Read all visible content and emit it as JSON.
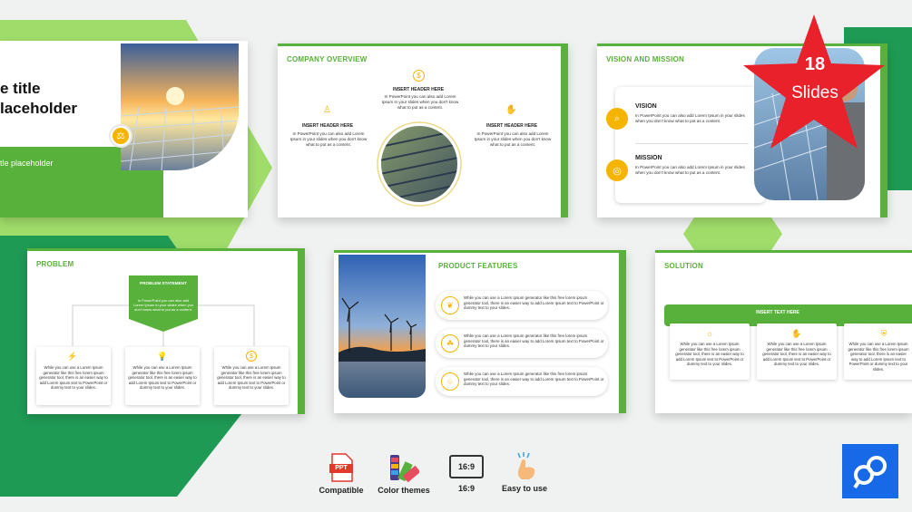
{
  "colors": {
    "accent_green": "#58b13a",
    "light_green": "#9fdc6a",
    "dark_green": "#1f9a55",
    "yellow_icon": "#f4b400",
    "star_red": "#e8212b",
    "logo_blue": "#1769e8"
  },
  "badge": {
    "count": "18",
    "label": "Slides"
  },
  "slide1": {
    "title_line1": "e title",
    "title_line2": "laceholder",
    "subtitle": "tle placeholder"
  },
  "slide2": {
    "title": "COMPANY OVERVIEW",
    "center_header": "INSERT HEADER HERE",
    "center_text": "In PowerPoint you can also add Lorem Ipsum in your slides when you don't know what to put as a content.",
    "left_header": "INSERT HEADER HERE",
    "left_text": "In PowerPoint you can also add Lorem Ipsum in your slides when you don't know what to put as a content.",
    "right_header": "INSERT HEADER HERE",
    "right_text": "In PowerPoint you can also add Lorem Ipsum in your slides when you don't know what to put as a content."
  },
  "slide3": {
    "title": "VISION AND MISSION",
    "vision_header": "VISION",
    "vision_text": "In PowerPoint you can also add Lorem Ipsum in your slides when you don't know what to put as a content.",
    "mission_header": "MISSION",
    "mission_text": "In PowerPoint you can also add Lorem Ipsum in your slides when you don't know what to put as a content."
  },
  "slide4": {
    "title": "PROBLEM",
    "statement_header": "PROBLEM STATEMENT",
    "statement_text": "In PowerPoint you can also add Lorem Ipsum in your slides when you don't know what to put as a content.",
    "cards": [
      "While you can use a Lorem Ipsum generator like this free lorem ipsum generator tool, there is an easier way to add Lorem Ipsum text to PowerPoint or dummy text to your slides.",
      "While you can use a Lorem Ipsum generator like this free lorem ipsum generator tool, there is an easier way to add Lorem Ipsum text to PowerPoint or dummy text to your slides.",
      "While you can use a Lorem Ipsum generator like this free lorem ipsum generator tool, there is an easier way to add Lorem Ipsum text to PowerPoint or dummy text to your slides."
    ]
  },
  "slide5": {
    "title": "PRODUCT FEATURES",
    "features": [
      "While you can use a Lorem Ipsum generator like this free lorem ipsum generator tool, there is an easier way to add Lorem Ipsum text to PowerPoint or dummy text to your slides.",
      "While you can use a Lorem Ipsum generator like this free lorem ipsum generator tool, there is an easier way to add Lorem Ipsum text to PowerPoint or dummy text to your slides.",
      "While you can use a Lorem Ipsum generator like this free lorem ipsum generator tool, there is an easier way to add Lorem Ipsum text to PowerPoint or dummy text to your slides."
    ]
  },
  "slide6": {
    "title": "SOLUTION",
    "banner": "INSERT TEXT HERE",
    "cards": [
      "While you can use a Lorem Ipsum generator like this free lorem ipsum generator tool, there is an easier way to add Lorem Ipsum text to PowerPoint or dummy text to your slides.",
      "While you can use a Lorem Ipsum generator like this free lorem ipsum generator tool, there is an easier way to add Lorem Ipsum text to PowerPoint or dummy text to your slides.",
      "While you can use a Lorem Ipsum generator like this free lorem ipsum generator tool, there is an easier way to add Lorem Ipsum text to PowerPoint or dummy text to your slides."
    ]
  },
  "features": {
    "ppt_badge": "PPT",
    "ppt": "Compatible",
    "color": "Color themes",
    "ratio_icon_text": "16:9",
    "ratio": "16:9",
    "easy": "Easy to use"
  }
}
